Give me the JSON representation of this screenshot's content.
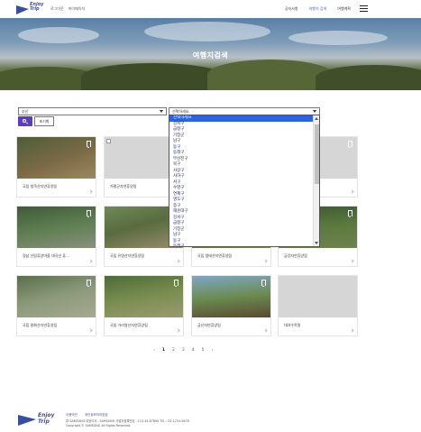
{
  "header": {
    "logo_text": "Enjoy\nTrip",
    "left_links": [
      "로그아웃",
      "마이페이지"
    ],
    "right_links": [
      "공지사항",
      "여행지 검색",
      "여행계획"
    ],
    "accent_color": "#4a5fc1"
  },
  "hero": {
    "title": "여행지검색"
  },
  "search": {
    "region_select": "부산",
    "district_select": "선택하세요",
    "reset_label": "초기화",
    "search_icon": "search-icon",
    "button_color": "#5a3fb8"
  },
  "dropdown": {
    "options": [
      "선택하세요",
      "강서구",
      "금정구",
      "기장군",
      "남구",
      "동구",
      "동래구",
      "부산진구",
      "북구",
      "사상구",
      "사하구",
      "서구",
      "수영구",
      "연제구",
      "영도구",
      "중구",
      "해운대구",
      "강서구",
      "금정구",
      "기장군",
      "남구",
      "동구",
      "동래구",
      "부산진구"
    ],
    "selected_index": 0,
    "selected_color": "#2f63d8"
  },
  "cards": [
    {
      "title": "국립 청옥산자연휴양림"
    },
    {
      "title": "가평군자연휴양림"
    },
    {
      "title": ""
    },
    {
      "title": ""
    },
    {
      "title": "경남 산림휴양마을 대곡산 휴…"
    },
    {
      "title": "국립 유명산자연휴양림"
    },
    {
      "title": "국립 청태산자연휴양림"
    },
    {
      "title": "금강자연휴양림"
    },
    {
      "title": "국립 용화산자연휴양림"
    },
    {
      "title": "국립 가리왕산자연휴양림"
    },
    {
      "title": "금산자연휴양림"
    },
    {
      "title": "대야수목원"
    }
  ],
  "pagination": [
    "‹",
    "1",
    "2",
    "3",
    "4",
    "5",
    "›"
  ],
  "footer": {
    "logo_text": "Enjoy\nTrip",
    "links": [
      "이용약관",
      "개인정보처리방침"
    ],
    "info": "㈜ SAMSUNG 대표이사 : SAMSUNG 사업자등록번호 : 123-45-67890 TEL : 02-1234-5678",
    "copyright": "Copyright © SAMSUNG All Rights Reserved."
  }
}
